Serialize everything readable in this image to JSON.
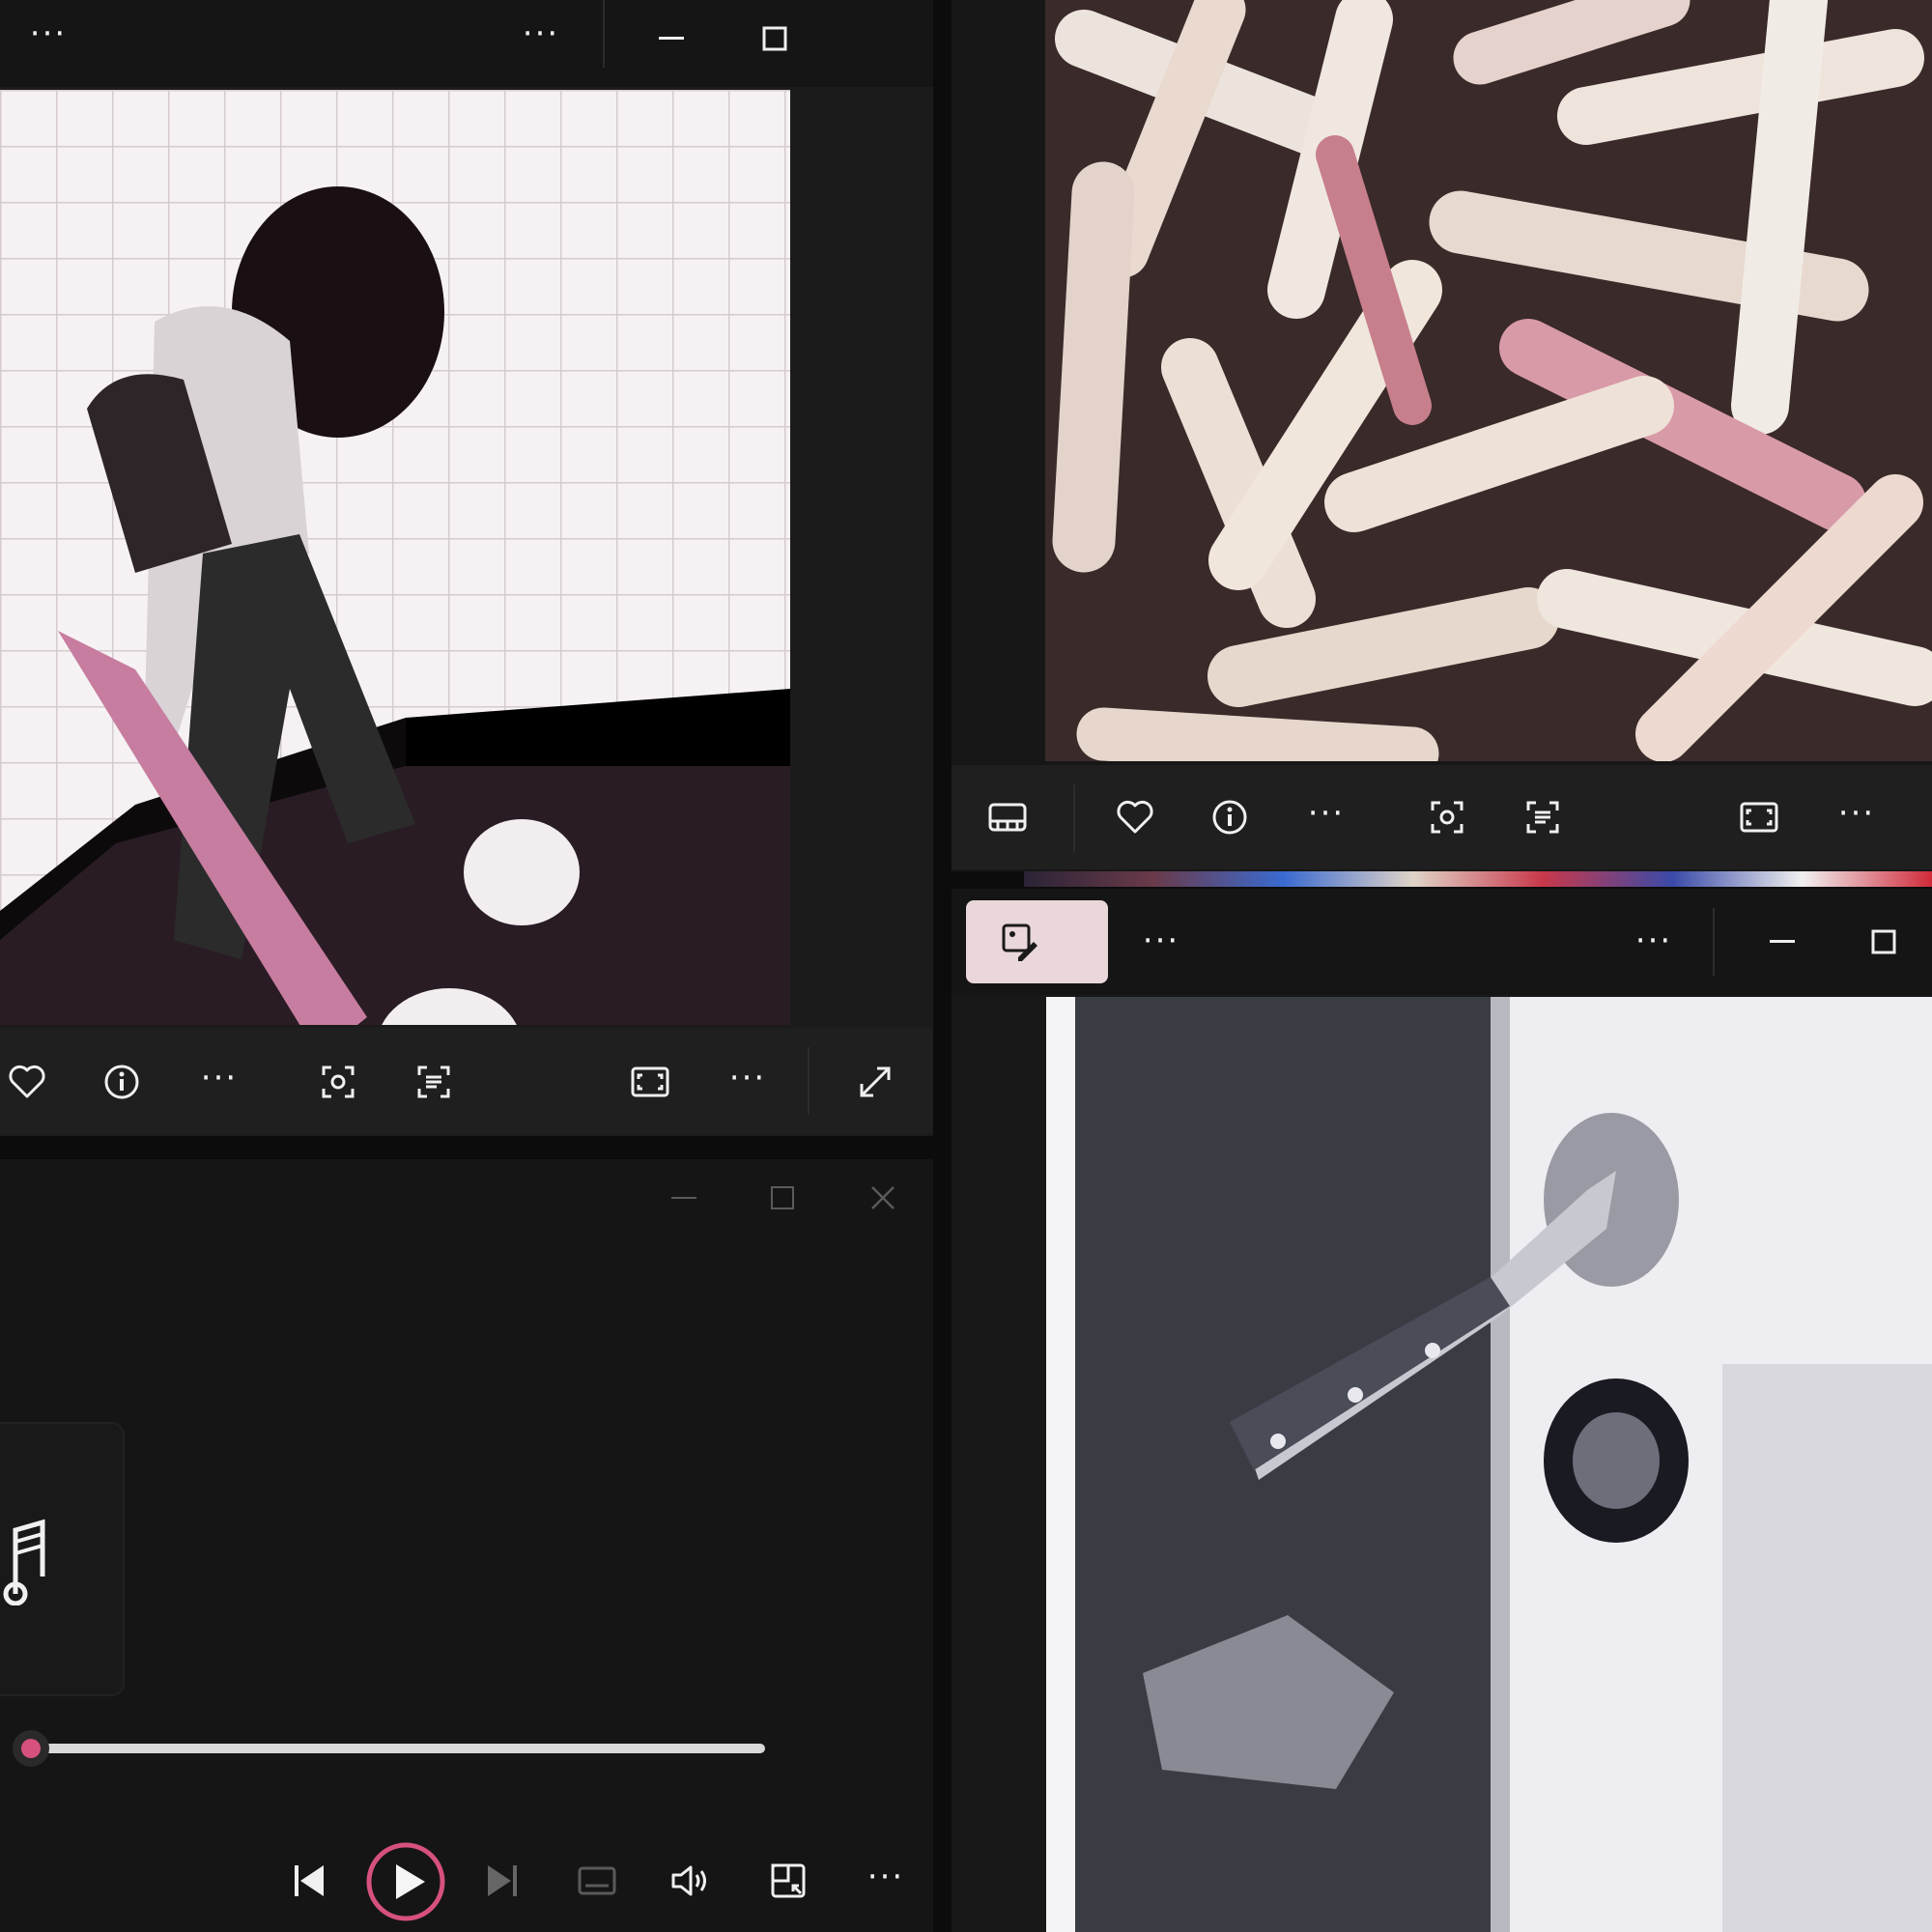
{
  "windows": {
    "top_left": {
      "titlebar": {
        "more_label": "···",
        "more2_label": "···"
      },
      "toolbar": {
        "more_label": "···",
        "more2_label": "···"
      }
    },
    "top_right": {
      "toolbar": {
        "more_label": "···",
        "more2_label": "···"
      }
    },
    "bottom_right": {
      "titlebar": {
        "more_label": "···",
        "more2_label": "···"
      }
    },
    "media_player": {
      "progress": 0.0,
      "more_label": "···"
    }
  },
  "colors": {
    "accent": "#d6517d",
    "edit_button_bg": "#e9d7da",
    "window_bg": "#1b1b1b"
  }
}
